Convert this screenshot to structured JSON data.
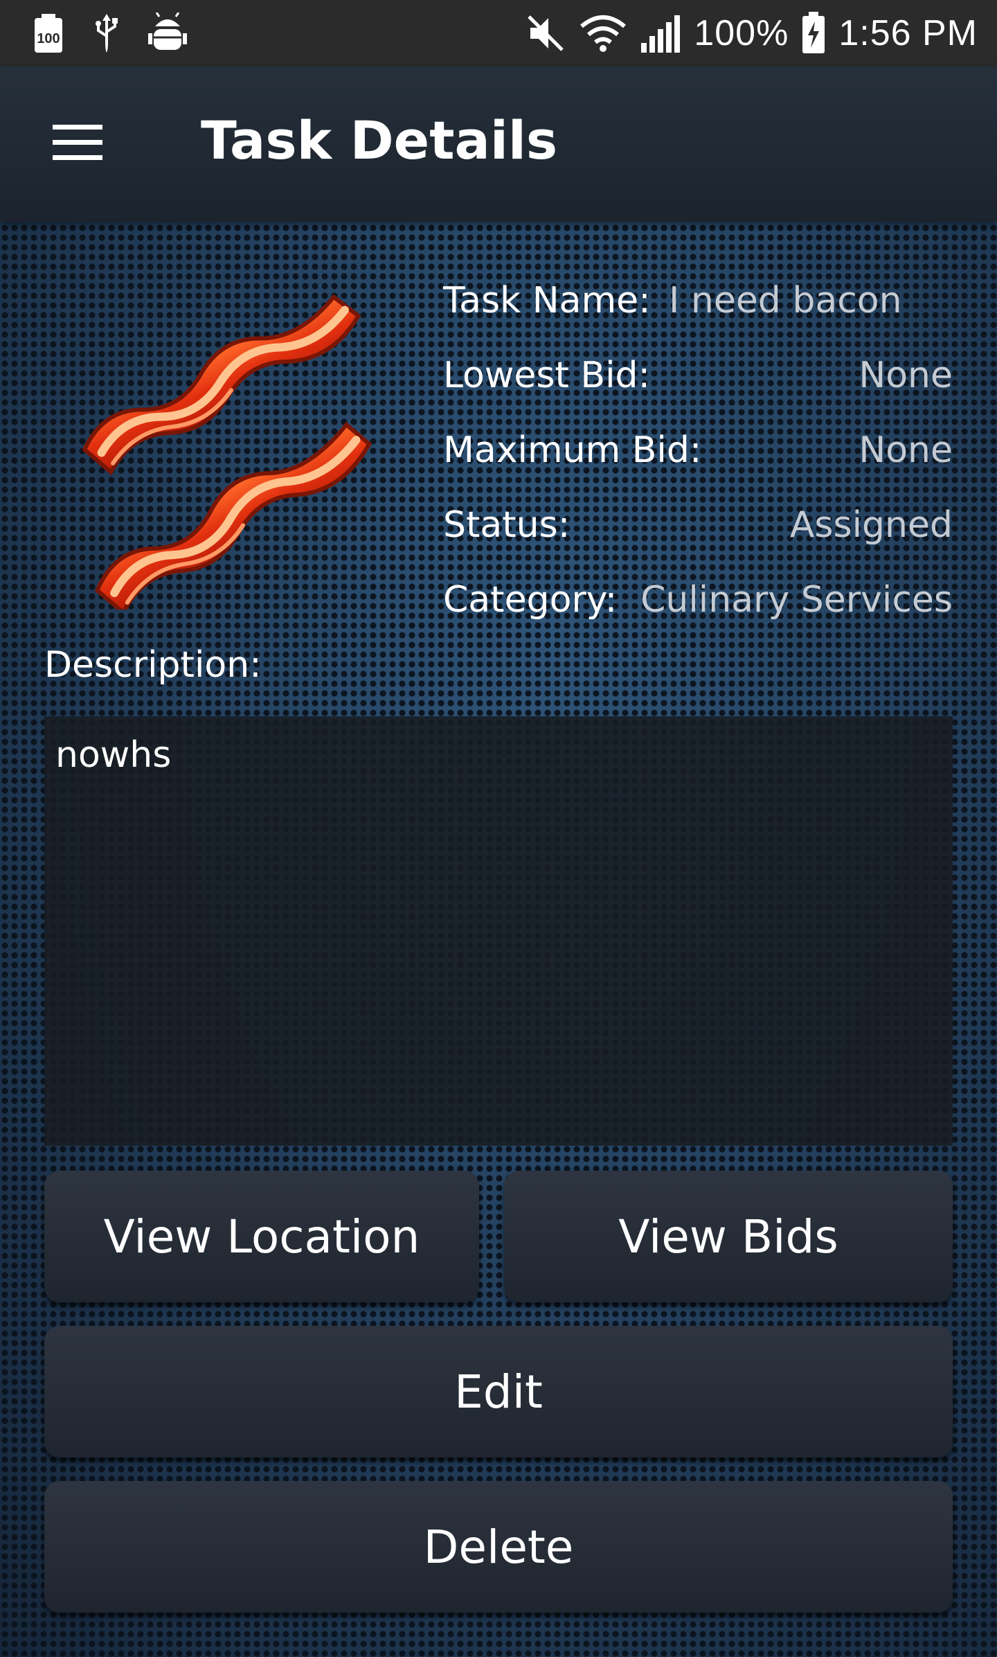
{
  "status_bar": {
    "battery_notification_label": "100",
    "battery_percent": "100%",
    "time": "1:56 PM",
    "icons": [
      "battery-100-icon",
      "usb-icon",
      "android-debug-icon",
      "mute-icon",
      "wifi-icon",
      "signal-icon",
      "battery-charging-icon"
    ]
  },
  "app_bar": {
    "title": "Task Details",
    "menu_icon": "hamburger-menu-icon"
  },
  "task": {
    "image_icon": "bacon-image",
    "fields": {
      "name_label": "Task Name:",
      "name_value": "I need bacon",
      "lowest_bid_label": "Lowest Bid:",
      "lowest_bid_value": "None",
      "maximum_bid_label": "Maximum Bid:",
      "maximum_bid_value": "None",
      "status_label": "Status:",
      "status_value": "Assigned",
      "category_label": "Category:",
      "category_value": "Culinary Services"
    },
    "description_label": "Description:",
    "description_value": "nowhs"
  },
  "buttons": {
    "view_location": "View Location",
    "view_bids": "View Bids",
    "edit": "Edit",
    "delete": "Delete"
  },
  "colors": {
    "value_text": "#c5cbd3",
    "app_bar": "#1c232c",
    "status_bar": "#2b2b2b",
    "background": "#24415f"
  }
}
